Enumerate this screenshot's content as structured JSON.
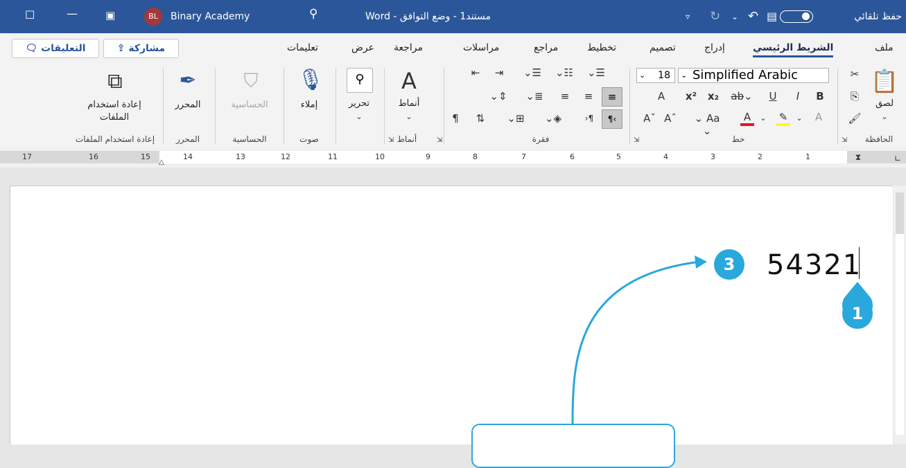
{
  "titlebar": {
    "document_title": "مستند1 - وضع التوافق - Word",
    "account_name": "Binary Academy",
    "avatar_initials": "BL",
    "autosave_label": "حفظ تلقائي",
    "icons": [
      "restore-icon",
      "minimize-icon",
      "ribbon-display-icon",
      "search-icon",
      "qat-customize-icon",
      "undo-icon",
      "redo-icon",
      "save-icon"
    ]
  },
  "tabs": [
    "ملف",
    "الشريط الرئيسي",
    "إدراج",
    "تصميم",
    "تخطيط",
    "مراجع",
    "مراسلات",
    "مراجعة",
    "عرض",
    "تعليمات"
  ],
  "active_tab": "الشريط الرئيسي",
  "share_button": "مشاركة",
  "comments_button": "التعليقات",
  "ribbon": {
    "clipboard": {
      "paste": "لصق",
      "group": "الحافظة"
    },
    "font": {
      "name": "Simplified Arabic",
      "size": "18",
      "group": "خط",
      "case": "Aa"
    },
    "paragraph": {
      "group": "فقرة"
    },
    "styles": {
      "label": "أنماط",
      "group": "أنماط"
    },
    "editing": {
      "label": "تحرير"
    },
    "voice": {
      "label": "إملاء",
      "group": "صوت"
    },
    "sensitivity": {
      "label": "الحساسية",
      "group": "الحساسية"
    },
    "editor": {
      "label": "المحرر",
      "group": "المحرر"
    },
    "reuse": {
      "label_line1": "إعادة استخدام",
      "label_line2": "الملفات",
      "group": "إعادة استخدام الملفات"
    }
  },
  "ruler_numbers": [
    "17",
    "16",
    "15",
    "14",
    "13",
    "12",
    "11",
    "10",
    "9",
    "8",
    "7",
    "6",
    "5",
    "4",
    "3",
    "2",
    "1"
  ],
  "document": {
    "text": "54321"
  },
  "badges": {
    "first": "1",
    "third": "3"
  },
  "colors": {
    "title_bar": "#2b579a",
    "badge": "#29a8dc",
    "font_color_swatch": "#e81123",
    "highlight_swatch": "#ffff00"
  }
}
